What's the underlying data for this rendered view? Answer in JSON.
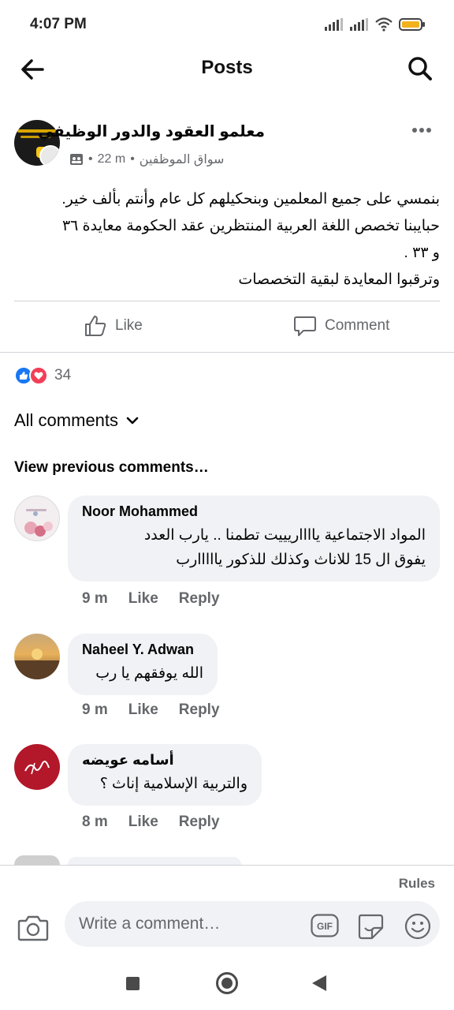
{
  "status_bar": {
    "time": "4:07 PM"
  },
  "topbar": {
    "title": "Posts"
  },
  "post": {
    "page_name": "معلمو العقود والدور الوظيفي",
    "meta_author": "سواق الموظفين",
    "meta_time": "22 m",
    "lines": [
      "بنمسي على جميع المعلمين وبنحكيلهم كل عام وأنتم بألف خير.",
      "حبايبنا تخصص اللغة العربية المنتظرين عقد الحكومة معايدة ٣٦",
      "و ٣٣ .",
      "وترقبوا المعايدة لبقية التخصصات"
    ],
    "like_label": "Like",
    "comment_label": "Comment",
    "reaction_count": "34"
  },
  "comments_section": {
    "filter_label": "All comments",
    "view_previous": "View previous comments…",
    "comments": [
      {
        "name": "Noor Mohammed",
        "lines": [
          "المواد الاجتماعية يااااريييت تطمنا .. يارب العدد",
          "يفوق ال 15 للاناث وكذلك للذكور يااااارب"
        ],
        "time": "9 m",
        "like": "Like",
        "reply": "Reply"
      },
      {
        "name": "Naheel Y. Adwan",
        "lines": [
          "الله يوفقهم يا رب"
        ],
        "time": "9 m",
        "like": "Like",
        "reply": "Reply"
      },
      {
        "name": "أسامه عويضه",
        "lines": [
          "والتربية الإسلامية إناث ؟"
        ],
        "time": "8 m",
        "like": "Like",
        "reply": "Reply"
      }
    ]
  },
  "composer": {
    "rules_label": "Rules",
    "placeholder": "Write a comment…"
  },
  "colors": {
    "like_blue": "#1877f2",
    "love_red": "#f33e58",
    "bubble_bg": "#f0f2f5",
    "secondary_text": "#65676b"
  }
}
